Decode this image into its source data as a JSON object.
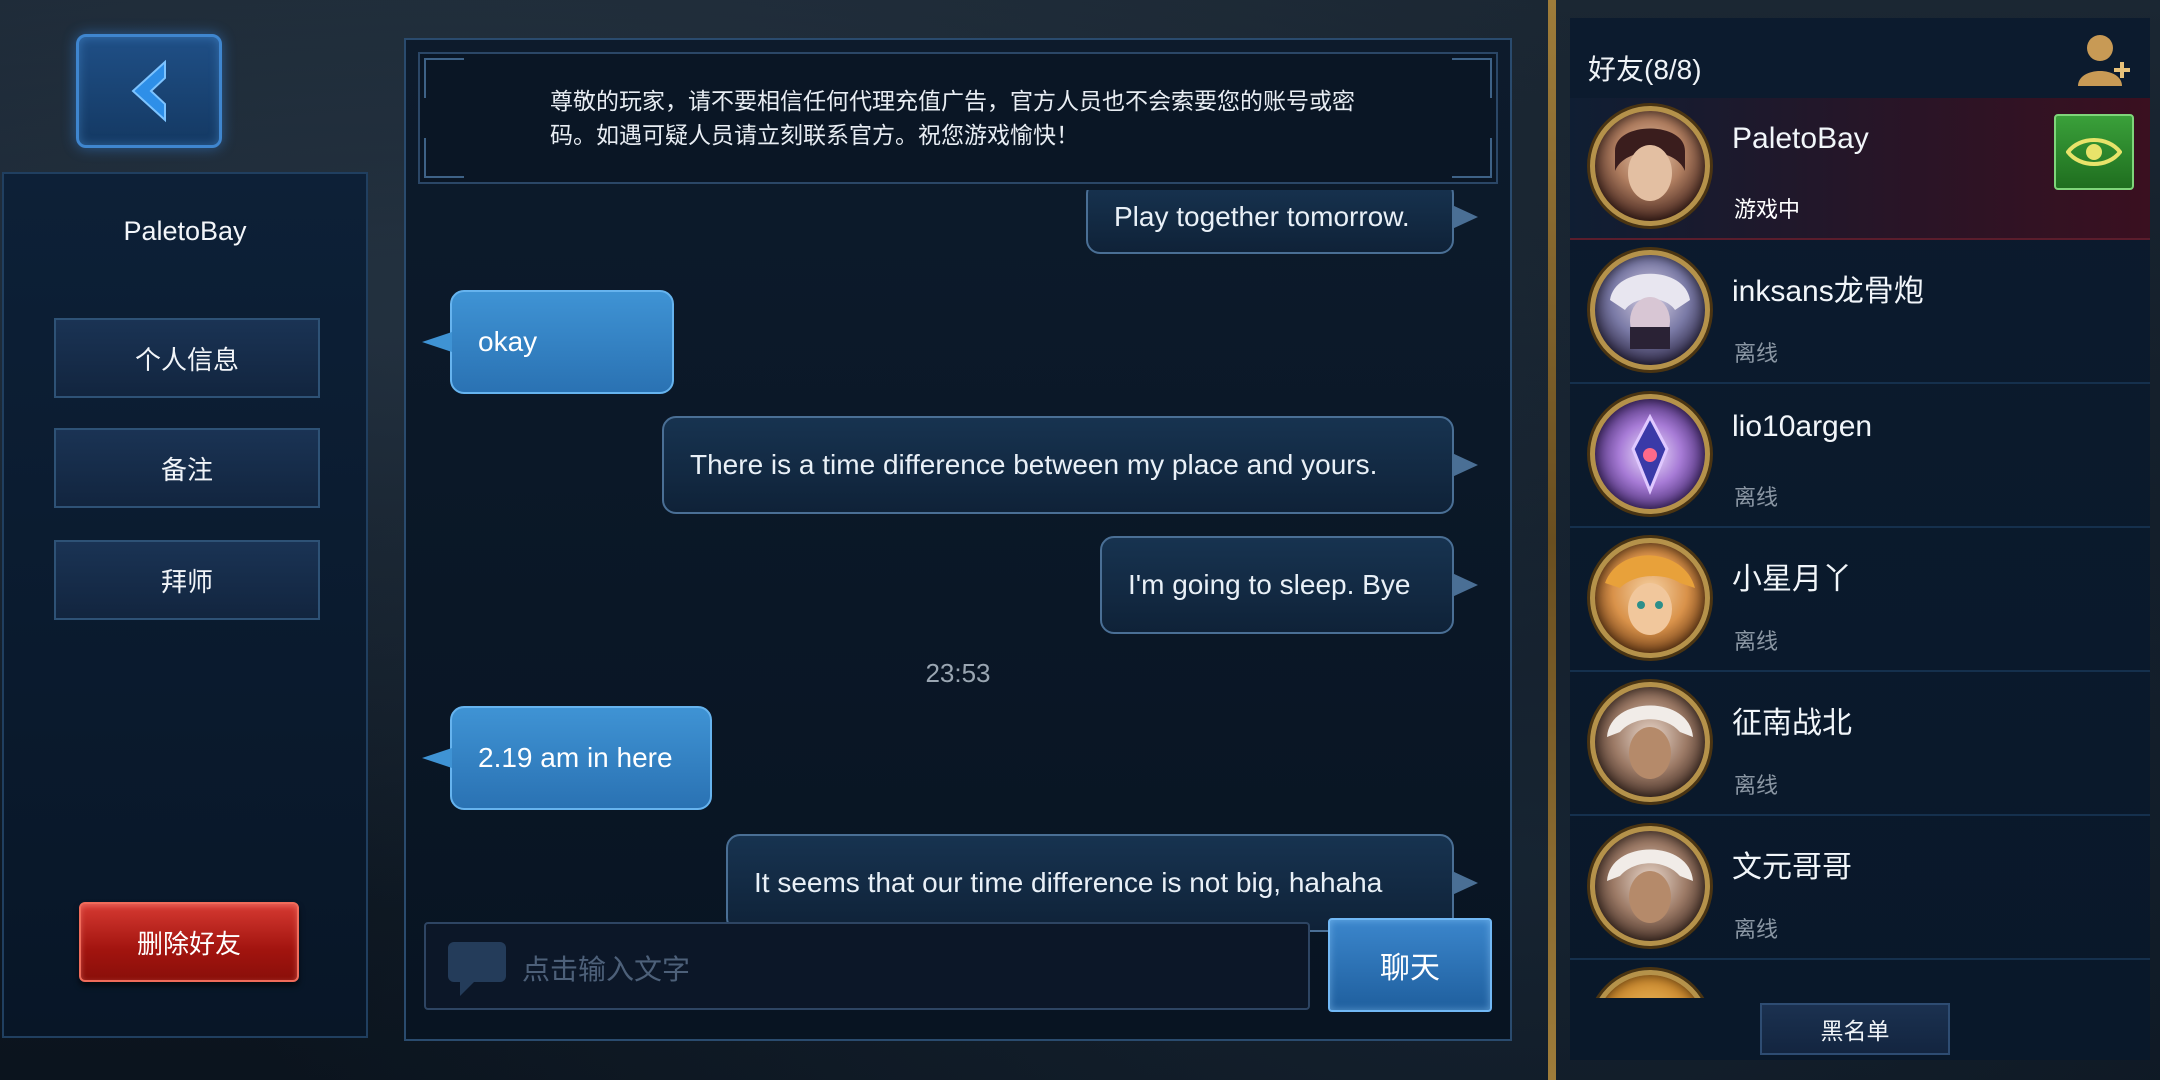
{
  "profile": {
    "name": "PaletoBay",
    "buttons": [
      "个人信息",
      "备注",
      "拜师"
    ],
    "delete_label": "删除好友"
  },
  "notice": {
    "text": "尊敬的玩家，请不要相信任何代理充值广告，官方人员也不会索要您的账号或密码。如遇可疑人员请立刻联系官方。祝您游戏愉快！"
  },
  "messages": [
    {
      "side": "out",
      "text": "Play together tomorrow."
    },
    {
      "side": "in",
      "text": "okay"
    },
    {
      "side": "out",
      "text": "There is a time difference between my place and yours."
    },
    {
      "side": "out",
      "text": "I'm going to sleep. Bye"
    },
    {
      "side": "time",
      "text": "23:53"
    },
    {
      "side": "in",
      "text": "2.19 am in here"
    },
    {
      "side": "out",
      "text": "It seems that our time difference is not big, hahaha"
    }
  ],
  "composer": {
    "placeholder": "点击输入文字",
    "send_label": "聊天"
  },
  "friends": {
    "title": "好友(8/8)",
    "items": [
      {
        "name": "PaletoBay",
        "status": "游戏中",
        "active": true
      },
      {
        "name": "inksans龙骨炮",
        "status": "离线"
      },
      {
        "name": "lio10argen",
        "status": "离线"
      },
      {
        "name": "小星月丫",
        "status": "离线"
      },
      {
        "name": "征南战北",
        "status": "离线"
      },
      {
        "name": "文元哥哥",
        "status": "离线"
      }
    ],
    "blacklist_label": "黑名单"
  },
  "colors": {
    "accent_blue": "#3f93d4",
    "delete_red": "#a2140f",
    "watch_green": "#3aa03a",
    "gold": "#b5924a"
  }
}
